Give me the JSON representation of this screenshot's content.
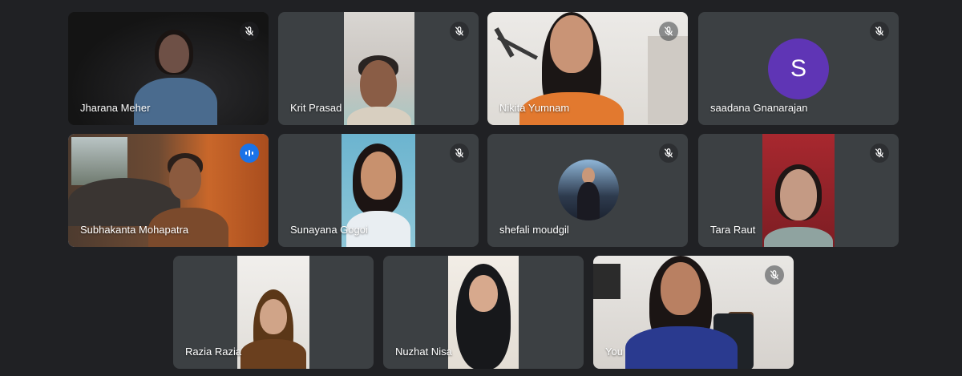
{
  "meeting": {
    "accent_color": "#8ab4f8",
    "speaking_color": "#1a73e8"
  },
  "participants": [
    {
      "name": "Jharana Meher",
      "muted": true,
      "icon": "mic-off-icon"
    },
    {
      "name": "Krit Prasad",
      "muted": true,
      "icon": "mic-off-icon"
    },
    {
      "name": "Nikita Yumnam",
      "muted": true,
      "icon": "mic-off-icon"
    },
    {
      "name": "saadana Gnanarajan",
      "muted": true,
      "icon": "mic-off-icon",
      "avatar_letter": "S",
      "avatar_color": "#5f35b5"
    },
    {
      "name": "Subhakanta Mohapatra",
      "muted": false,
      "speaking": true,
      "icon": "audio-level-icon"
    },
    {
      "name": "Sunayana Gogoi",
      "muted": true,
      "icon": "mic-off-icon"
    },
    {
      "name": "shefali moudgil",
      "muted": true,
      "icon": "mic-off-icon"
    },
    {
      "name": "Tara Raut",
      "muted": true,
      "icon": "mic-off-icon"
    },
    {
      "name": "Razia Razia",
      "muted": false
    },
    {
      "name": "Nuzhat Nisa",
      "muted": false
    },
    {
      "name": "You",
      "muted": true,
      "icon": "mic-off-icon"
    }
  ]
}
